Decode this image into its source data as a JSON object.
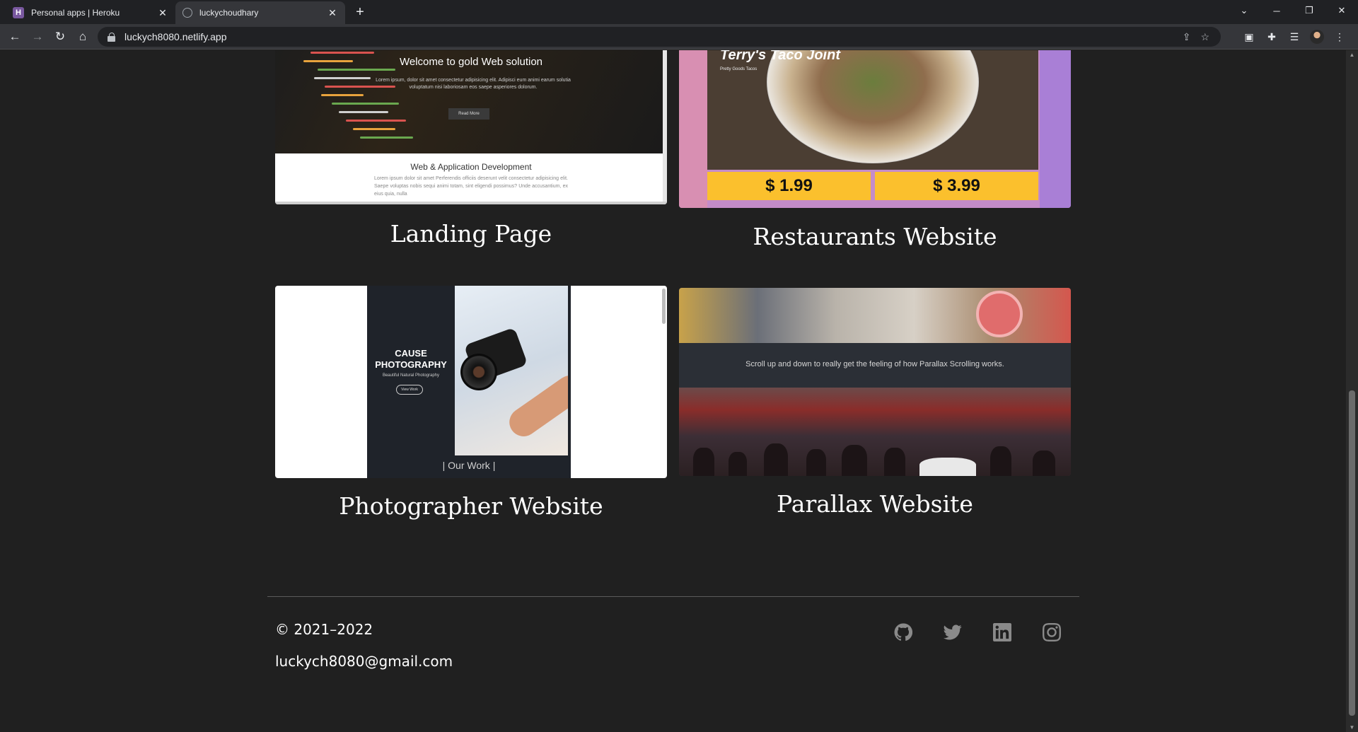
{
  "browser": {
    "tabs": [
      {
        "title": "Personal apps | Heroku",
        "active": false,
        "icon": "heroku-icon"
      },
      {
        "title": "luckychoudhary",
        "active": true,
        "icon": "globe-icon"
      }
    ],
    "url": "luckych8080.netlify.app"
  },
  "projects": [
    {
      "title": "Landing Page",
      "shot": {
        "heading": "Welcome to gold Web solution",
        "subtext": "Lorem ipsum, dolor sit amet consectetur adipisicing elit. Adipisci eum animi earum solutia voluptatum nisi laboriosam eos saepe asperiores dolorum.",
        "button": "Read More",
        "section_heading": "Web & Application Development",
        "section_body": "Lorem ipsum dolor sit amet Perferendis officiis deserunt velit consectetur adipisicing elit. Saepe voluptas nobis sequi animi totam, sint eligendi possimus? Unde accusantium, ex eius quia, nulla"
      }
    },
    {
      "title": "Restaurants Website",
      "shot": {
        "heading": "Terry's Taco Joint",
        "subtext": "Pretty Goods Tacos",
        "prices": [
          "$ 1.99",
          "$ 3.99"
        ]
      }
    },
    {
      "title": "Photographer Website",
      "shot": {
        "heading": "CAUSE PHOTOGRAPHY",
        "subtext": "Beautiful Natural Photography",
        "button": "View Work",
        "section_heading": "| Our Work |"
      }
    },
    {
      "title": "Parallax Website",
      "shot": {
        "band_text": "Scroll up and down to really get the feeling of how Parallax Scrolling works."
      }
    }
  ],
  "footer": {
    "copyright": "© 2021–2022",
    "email": "luckych8080@gmail.com",
    "social": [
      "github-icon",
      "twitter-icon",
      "linkedin-icon",
      "instagram-icon"
    ]
  }
}
